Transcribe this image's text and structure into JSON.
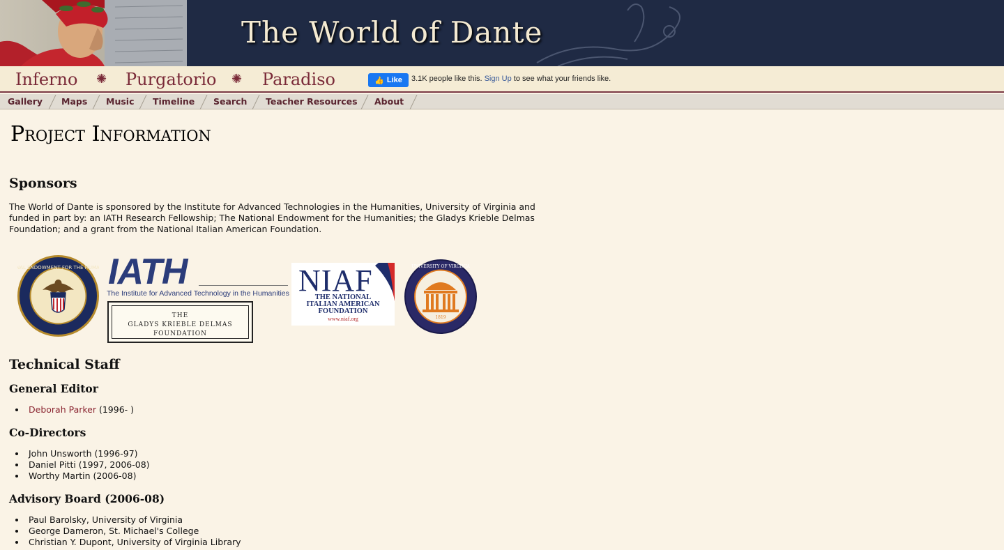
{
  "header": {
    "title": "The World of Dante"
  },
  "canticas": [
    "Inferno",
    "Purgatorio",
    "Paradiso"
  ],
  "facebook": {
    "like_label": "Like",
    "count_text": "3.1K people like this.",
    "signup_label": "Sign Up",
    "suffix_text": "to see what your friends like."
  },
  "nav": [
    "Gallery",
    "Maps",
    "Music",
    "Timeline",
    "Search",
    "Teacher Resources",
    "About"
  ],
  "page": {
    "title": "Project Information"
  },
  "sponsors": {
    "heading": "Sponsors",
    "text": "The World of Dante is sponsored by the Institute for Advanced Technologies in the Humanities, University of Virginia and funded in part by: an IATH Research Fellowship; The National Endowment for the Humanities; the Gladys Krieble Delmas Foundation; and a grant from the National Italian American Foundation.",
    "logos": {
      "neh_text": "NATIONAL ENDOWMENT FOR THE HUMANITIES",
      "iath_title": "IATH",
      "iath_sub": "The Institute for Advanced Technology in the Humanities",
      "gkd_line1": "THE",
      "gkd_line2": "GLADYS KRIEBLE DELMAS",
      "gkd_line3": "FOUNDATION",
      "niaf_title": "NIAF",
      "niaf_line1": "THE NATIONAL",
      "niaf_line2": "ITALIAN AMERICAN",
      "niaf_line3": "FOUNDATION",
      "niaf_url": "www.niaf.org",
      "uva_text": "UNIVERSITY OF VIRGINIA",
      "uva_year": "1819"
    }
  },
  "technical_staff": {
    "heading": "Technical Staff",
    "general_editor": {
      "heading": "General Editor",
      "name": "Deborah Parker",
      "years": " (1996- )"
    },
    "co_directors": {
      "heading": "Co-Directors",
      "items": [
        "John Unsworth (1996-97)",
        "Daniel Pitti (1997, 2006-08)",
        "Worthy Martin (2006-08)"
      ]
    },
    "advisory_board": {
      "heading": "Advisory Board (2006-08)",
      "items": [
        "Paul Barolsky, University of Virginia",
        "George Dameron, St. Michael's College",
        "Christian Y. Dupont, University of Virginia Library"
      ]
    }
  },
  "colors": {
    "banner": "#1f2a44",
    "accent": "#7a2a38",
    "background": "#faf3e6",
    "link": "#8b2632"
  }
}
